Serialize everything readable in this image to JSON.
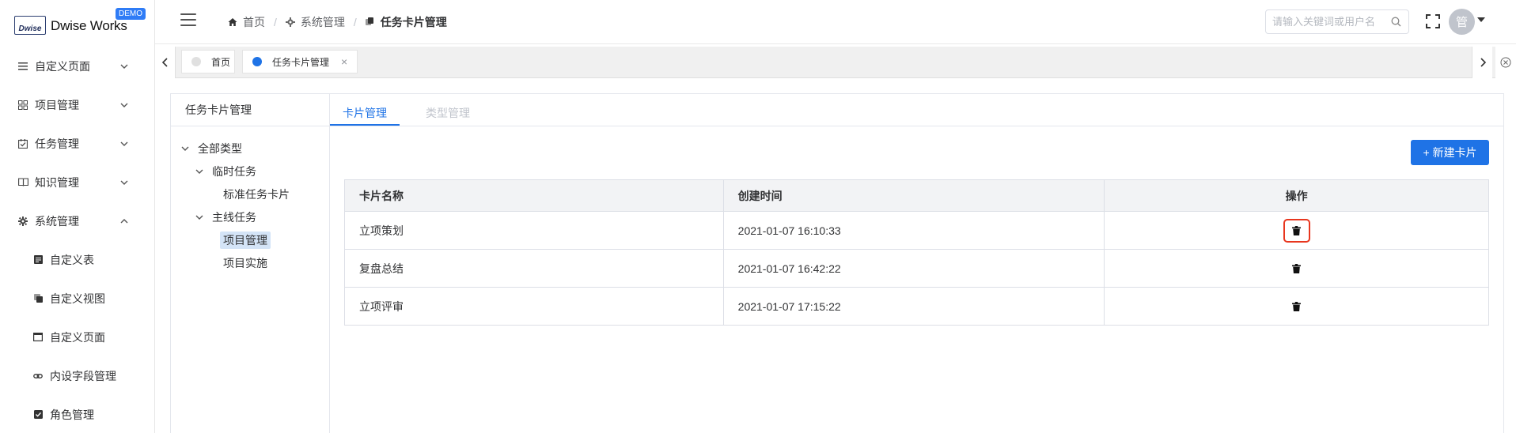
{
  "logo": {
    "mark": "Dwise",
    "text": "Dwise Works",
    "badge": "DEMO"
  },
  "sidebar": {
    "items": [
      {
        "label": "自定义页面",
        "icon": "list-icon",
        "expanded": false
      },
      {
        "label": "项目管理",
        "icon": "grid-icon",
        "expanded": false
      },
      {
        "label": "任务管理",
        "icon": "calendar-check-icon",
        "expanded": false
      },
      {
        "label": "知识管理",
        "icon": "book-icon",
        "expanded": false
      },
      {
        "label": "系统管理",
        "icon": "gear-icon",
        "expanded": true
      }
    ],
    "subitems": [
      {
        "label": "自定义表",
        "icon": "table-icon"
      },
      {
        "label": "自定义视图",
        "icon": "copy-icon"
      },
      {
        "label": "自定义页面",
        "icon": "window-icon"
      },
      {
        "label": "内设字段管理",
        "icon": "link-icon"
      },
      {
        "label": "角色管理",
        "icon": "checkbox-icon"
      }
    ]
  },
  "header": {
    "breadcrumb": [
      {
        "label": "首页",
        "icon": "home-icon"
      },
      {
        "label": "系统管理",
        "icon": "gear-icon"
      },
      {
        "label": "任务卡片管理",
        "icon": "copy-icon"
      }
    ],
    "search_placeholder": "请输入关键词或用户名",
    "avatar_text": "管"
  },
  "tabs": [
    {
      "label": "首页",
      "active": false,
      "dot_color": "#e0e0e0"
    },
    {
      "label": "任务卡片管理",
      "active": true,
      "dot_color": "#1f73e6",
      "close": "×"
    }
  ],
  "tree": {
    "title": "任务卡片管理",
    "nodes": [
      {
        "label": "全部类型",
        "level": 0,
        "expandable": true
      },
      {
        "label": "临时任务",
        "level": 1,
        "expandable": true
      },
      {
        "label": "标准任务卡片",
        "level": 2,
        "expandable": false
      },
      {
        "label": "主线任务",
        "level": 1,
        "expandable": true
      },
      {
        "label": "项目管理",
        "level": 2,
        "expandable": false,
        "selected": true
      },
      {
        "label": "项目实施",
        "level": 2,
        "expandable": false
      }
    ]
  },
  "main": {
    "tabs": [
      {
        "label": "卡片管理",
        "active": true
      },
      {
        "label": "类型管理",
        "active": false
      }
    ],
    "new_button": "+ 新建卡片",
    "table": {
      "headers": [
        "卡片名称",
        "创建时间",
        "操作"
      ],
      "rows": [
        {
          "name": "立项策划",
          "created": "2021-01-07 16:10:33"
        },
        {
          "name": "复盘总结",
          "created": "2021-01-07 16:42:22"
        },
        {
          "name": "立项评审",
          "created": "2021-01-07 17:15:22"
        }
      ]
    }
  },
  "colors": {
    "primary": "#1f73e6",
    "highlight": "#e8361e"
  }
}
